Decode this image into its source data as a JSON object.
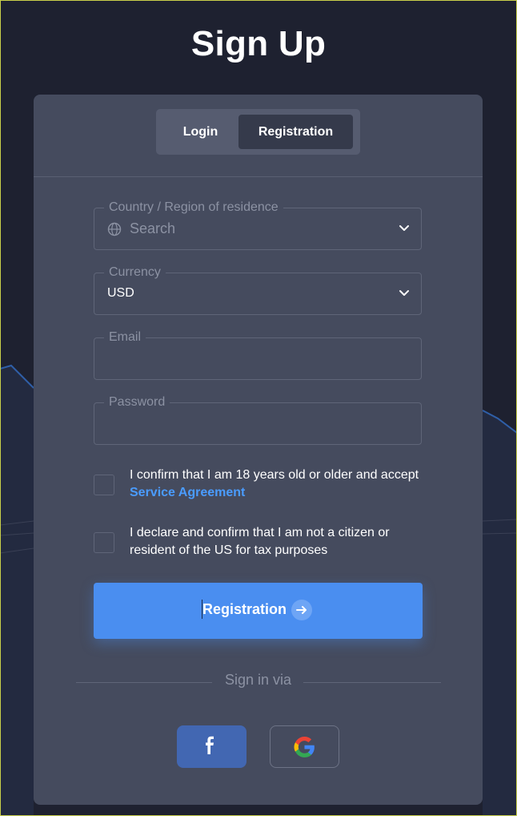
{
  "page": {
    "title": "Sign Up"
  },
  "tabs": [
    {
      "label": "Login",
      "active": false
    },
    {
      "label": "Registration",
      "active": true
    }
  ],
  "form": {
    "country": {
      "label": "Country / Region of residence",
      "placeholder": "Search",
      "icon": "globe-icon"
    },
    "currency": {
      "label": "Currency",
      "value": "USD"
    },
    "email": {
      "label": "Email",
      "value": ""
    },
    "password": {
      "label": "Password",
      "value": ""
    }
  },
  "checkboxes": {
    "age": {
      "text": "I confirm that I am 18 years old or older and accept",
      "link": "Service Agreement",
      "checked": false
    },
    "us_tax": {
      "text": "I declare and confirm that I am not a citizen or resident of the US for tax purposes",
      "checked": false
    }
  },
  "submit": {
    "label": "Registration",
    "icon": "arrow-right-icon"
  },
  "social": {
    "divider_text": "Sign in via",
    "facebook_icon": "facebook-icon",
    "google_icon": "google-icon"
  },
  "colors": {
    "background": "#1e2130",
    "card": "#454b5e",
    "accent": "#4a8ef0",
    "link": "#4a9cff",
    "facebook": "#4267b2"
  }
}
